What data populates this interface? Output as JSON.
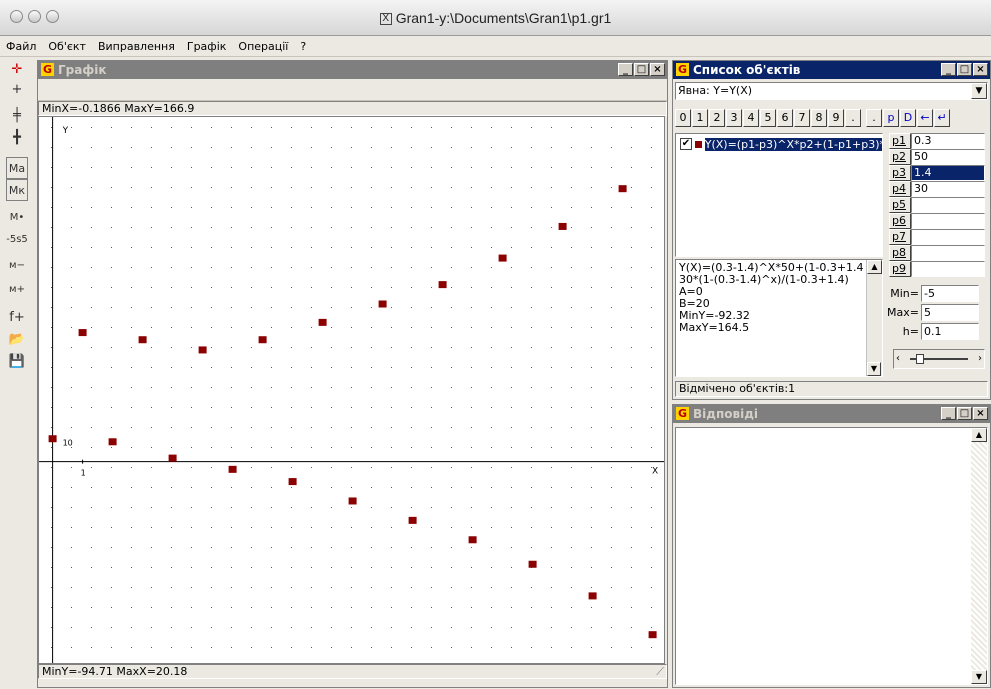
{
  "window": {
    "title": "Gran1-y:\\Documents\\Gran1\\p1.gr1"
  },
  "menu": [
    "Файл",
    "Об'єкт",
    "Виправлення",
    "Графік",
    "Операції",
    "?"
  ],
  "toolbar": [
    {
      "icon": "axes-cross-icon",
      "glyph": "✛"
    },
    {
      "icon": "plus-icon",
      "glyph": "+"
    },
    {
      "icon": "axes-shift-icon",
      "glyph": "╪"
    },
    {
      "icon": "axes-tilt-icon",
      "glyph": "╋"
    },
    {
      "icon": "scale-auto-icon",
      "glyph": "Ма"
    },
    {
      "icon": "scale-coord-icon",
      "glyph": "Мк"
    },
    {
      "icon": "scale-point-icon",
      "glyph": "М•"
    },
    {
      "icon": "scale-step-icon",
      "glyph": "-5s5"
    },
    {
      "icon": "zoom-out-icon",
      "glyph": "м−"
    },
    {
      "icon": "zoom-in-icon",
      "glyph": "м+"
    },
    {
      "icon": "add-function-icon",
      "glyph": "f+"
    },
    {
      "icon": "open-folder-icon",
      "glyph": "📂"
    },
    {
      "icon": "save-icon",
      "glyph": "💾"
    }
  ],
  "graph": {
    "title": "Графік",
    "status_top": "MinX=-0.1866  MaxY=166.9",
    "status_bottom": "MinY=-94.71  MaxX=20.18",
    "axis_y_label": "Y",
    "axis_x_label": "X",
    "tick_y": "10",
    "tick_x": "1",
    "point_color": "#8b0000"
  },
  "chart_data": {
    "type": "scatter",
    "title": "",
    "xlabel": "X",
    "ylabel": "Y",
    "xlim": [
      -0.1866,
      20.18
    ],
    "ylim": [
      -94.71,
      166.9
    ],
    "grid": true,
    "series": [
      {
        "values": [
          [
            0,
            11.0
          ],
          [
            1,
            63.0
          ],
          [
            2,
            9.5
          ],
          [
            3,
            59.5
          ],
          [
            4,
            1.5
          ],
          [
            5,
            54.5
          ],
          [
            6,
            -4.0
          ],
          [
            7,
            59.5
          ],
          [
            8,
            -10.0
          ],
          [
            9,
            68.0
          ],
          [
            10,
            -19.5
          ],
          [
            11,
            77.0
          ],
          [
            12,
            -29.0
          ],
          [
            13,
            86.5
          ],
          [
            14,
            -38.5
          ],
          [
            15,
            99.5
          ],
          [
            16,
            -50.5
          ],
          [
            17,
            115.0
          ],
          [
            18,
            -66.0
          ],
          [
            19,
            133.5
          ],
          [
            20,
            -85.0
          ],
          [
            21,
            155.0
          ]
        ]
      }
    ]
  },
  "objects": {
    "title": "Список об'єктів",
    "type_select": "Явна: Y=Y(X)",
    "keypad": [
      "0",
      "1",
      "2",
      "3",
      "4",
      "5",
      "6",
      "7",
      "8",
      "9",
      ".",
      ".",
      "p",
      "D",
      "←",
      "↵"
    ],
    "item": "Y(X)=(p1-p3)^X*p2+(1-p1+p3)*",
    "info_lines": [
      "Y(X)=(0.3-1.4)^X*50+(1-0.3+1.4)*",
      "30*(1-(0.3-1.4)^x)/(1-0.3+1.4)",
      "A=0",
      "B=20",
      "MinY=-92.32",
      "MaxY=164.5"
    ],
    "params": [
      {
        "name": "p1",
        "value": "0.3"
      },
      {
        "name": "p2",
        "value": "50"
      },
      {
        "name": "p3",
        "value": "1.4"
      },
      {
        "name": "p4",
        "value": "30"
      },
      {
        "name": "p5",
        "value": ""
      },
      {
        "name": "p6",
        "value": ""
      },
      {
        "name": "p7",
        "value": ""
      },
      {
        "name": "p8",
        "value": ""
      },
      {
        "name": "p9",
        "value": ""
      }
    ],
    "min_label": "Min=",
    "min_value": "-5",
    "max_label": "Max=",
    "max_value": "5",
    "h_label": "h=",
    "h_value": "0.1",
    "status": "Відмічено об'єктів:1"
  },
  "answers": {
    "title": "Відповіді"
  }
}
